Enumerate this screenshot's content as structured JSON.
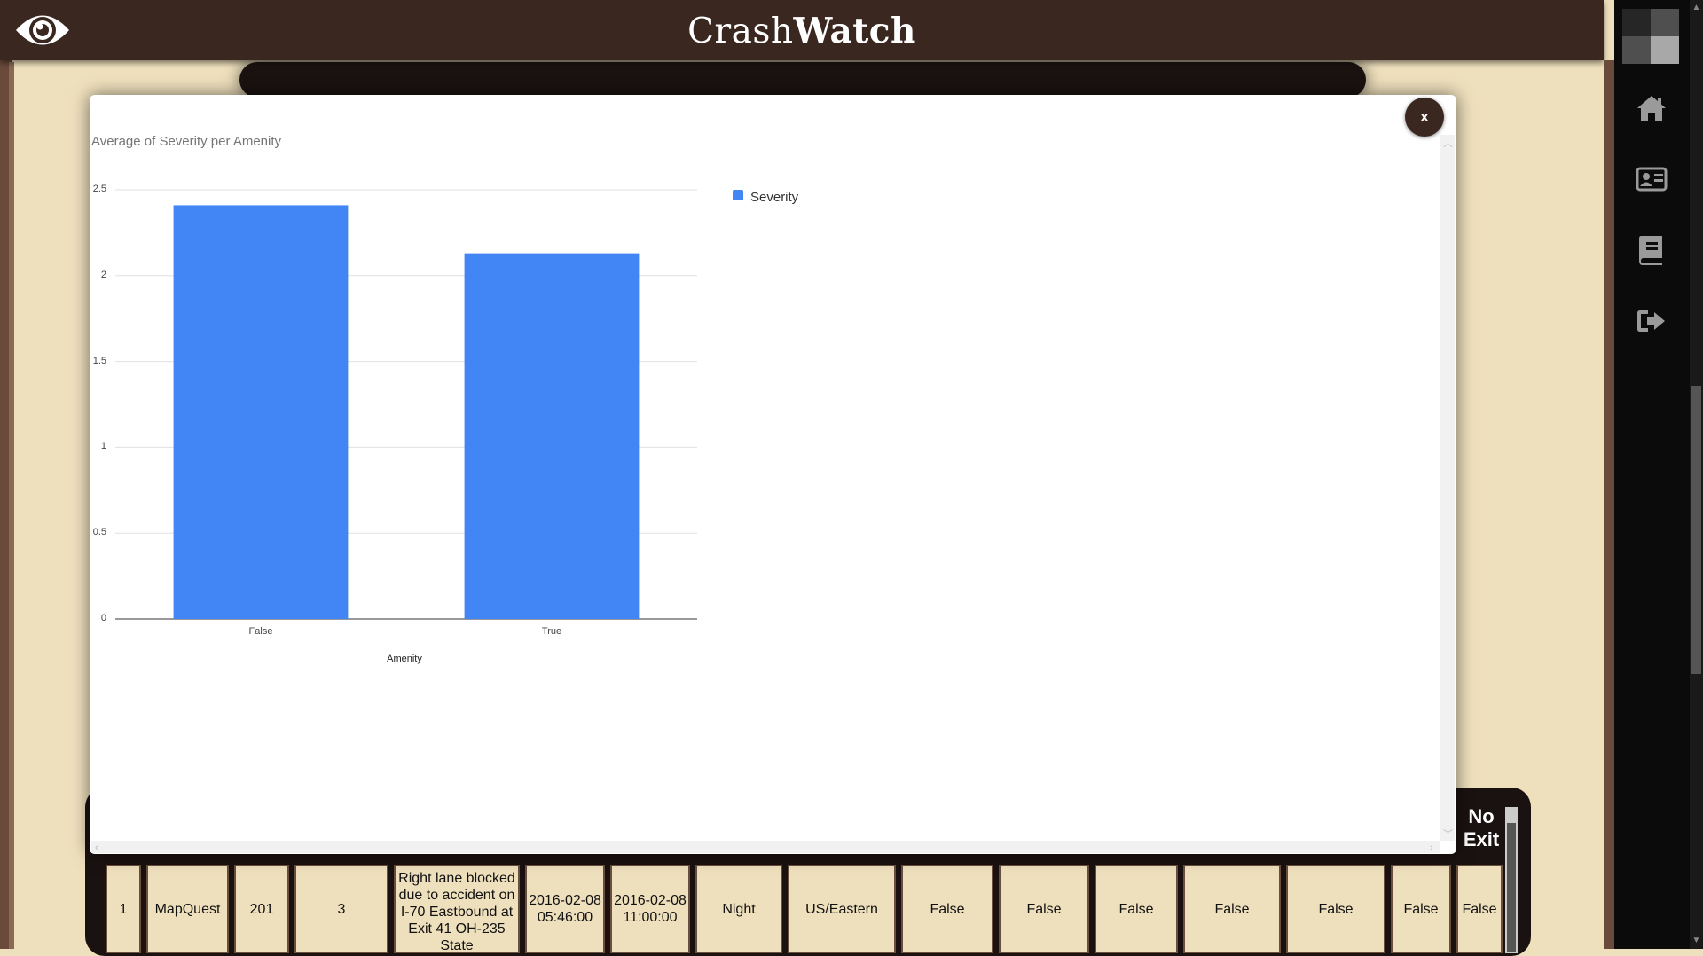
{
  "app": {
    "brand_light": "Crash",
    "brand_bold": "Watch"
  },
  "sidebar": {
    "icons": [
      "home-icon",
      "id-card-icon",
      "book-icon",
      "logout-icon"
    ]
  },
  "modal": {
    "close_label": "x"
  },
  "table": {
    "header_partial": "No Exit",
    "row": [
      "1",
      "MapQuest",
      "201",
      "3",
      "Right lane blocked due to accident on I-70 Eastbound at Exit 41 OH-235 State",
      "2016-02-08 05:46:00",
      "2016-02-08 11:00:00",
      "Night",
      "US/Eastern",
      "False",
      "False",
      "False",
      "False",
      "False",
      "False",
      "False"
    ]
  },
  "chart_data": {
    "type": "bar",
    "title": "Average of Severity per Amenity",
    "xlabel": "Amenity",
    "ylabel": "",
    "categories": [
      "False",
      "True"
    ],
    "series": [
      {
        "name": "Severity",
        "values": [
          2.41,
          2.13
        ],
        "color": "#4285f4"
      }
    ],
    "ylim": [
      0,
      2.5
    ],
    "yticks": [
      "0",
      "0.5",
      "1",
      "1.5",
      "2",
      "2.5"
    ],
    "legend": "top-right",
    "grid": true
  }
}
